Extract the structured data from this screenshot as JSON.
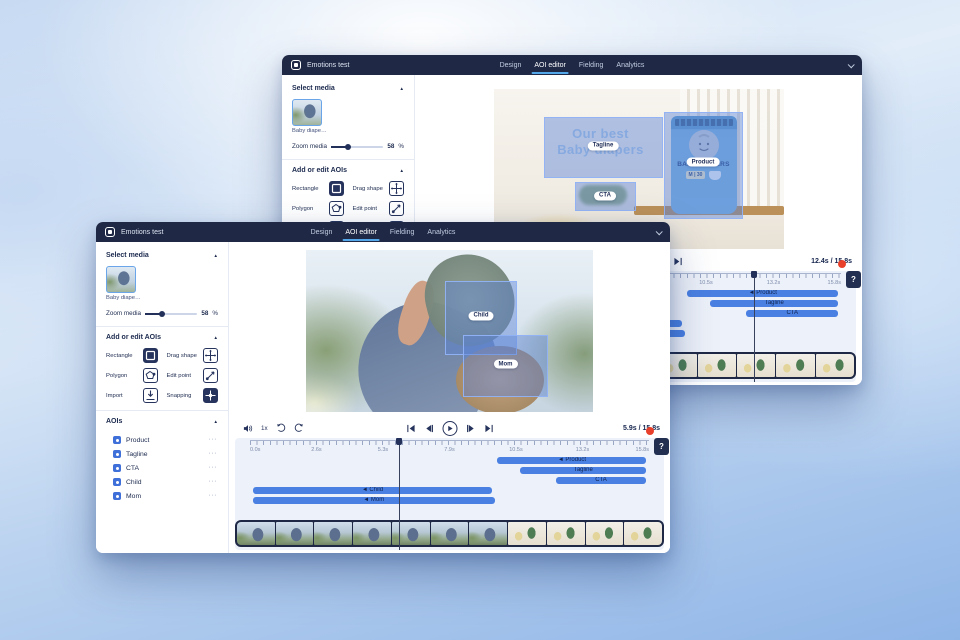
{
  "app": {
    "title": "Emotions test",
    "tabs": [
      {
        "label": "Design",
        "active": false
      },
      {
        "label": "AOI editor",
        "active": true
      },
      {
        "label": "Fielding",
        "active": false
      },
      {
        "label": "Analytics",
        "active": false
      }
    ],
    "active_tab": "AOI editor"
  },
  "sidebar": {
    "select_media": {
      "heading": "Select media",
      "thumbnail_caption": "Baby diape…",
      "zoom_label": "Zoom media",
      "zoom_value": "58",
      "zoom_unit": "%"
    },
    "aoi_tools": {
      "heading": "Add or edit AOIs",
      "tools": [
        {
          "label": "Rectangle",
          "active": true
        },
        {
          "label": "Drag shape",
          "active": false
        },
        {
          "label": "Polygon",
          "active": false
        },
        {
          "label": "Edit point",
          "active": false
        },
        {
          "label": "Import",
          "active": false
        },
        {
          "label": "Snapping",
          "active": true
        }
      ]
    },
    "aoi_list": {
      "heading": "AOIs",
      "items": [
        "Product",
        "Tagline",
        "CTA",
        "Child",
        "Mom"
      ],
      "menu_glyph": "···"
    }
  },
  "playback": {
    "speed_label": "1x"
  },
  "windows": {
    "back": {
      "time_display": "12.4s / 15.8s",
      "playhead_s": 12.4
    },
    "front": {
      "time_display": "5.9s / 15.8s",
      "playhead_s": 5.9
    }
  },
  "timeline": {
    "duration_s": 15.8,
    "tick_labels": [
      "0.0s",
      "2.6s",
      "5.3s",
      "7.9s",
      "10.5s",
      "13.2s",
      "15.8s"
    ],
    "marker_glyph": "◄",
    "help_label": "?",
    "bars": [
      {
        "label": "Product",
        "start_s": 9.8,
        "end_s": 15.7,
        "marker": true
      },
      {
        "label": "Tagline",
        "start_s": 10.7,
        "end_s": 15.7,
        "marker": false
      },
      {
        "label": "CTA",
        "start_s": 12.1,
        "end_s": 15.7,
        "marker": false
      },
      {
        "label": "Child",
        "start_s": 0.1,
        "end_s": 9.6,
        "marker": true
      },
      {
        "label": "Mom",
        "start_s": 0.1,
        "end_s": 9.7,
        "marker": true
      }
    ]
  },
  "front_canvas": {
    "aois": [
      "Child",
      "Mom"
    ]
  },
  "back_canvas": {
    "headline_line1": "Our best",
    "headline_line2": "Baby diapers",
    "aois": [
      "Tagline",
      "Product",
      "CTA"
    ],
    "package_brand": "BABY DIAPERS",
    "package_size": "M | 30"
  },
  "filmstrip": {
    "back_frames": [
      "outdoor",
      "outdoor",
      "outdoor",
      "product",
      "product",
      "product",
      "product",
      "product",
      "product",
      "product",
      "product"
    ],
    "front_frames": [
      "outdoor",
      "outdoor",
      "outdoor",
      "outdoor",
      "outdoor",
      "outdoor",
      "outdoor",
      "product",
      "product",
      "product",
      "product"
    ]
  },
  "colors": {
    "header_navy": "#1f2946",
    "accent_blue": "#4a80e2",
    "tab_underline": "#54a8e9",
    "alert_red": "#e8402a"
  }
}
